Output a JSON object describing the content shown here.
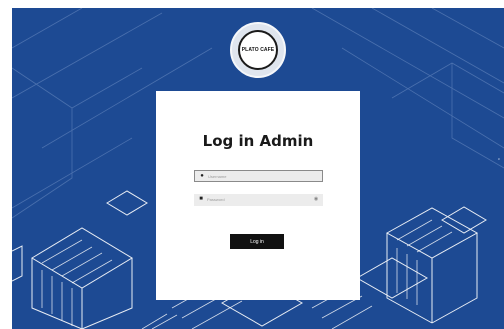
{
  "brand": {
    "logo_text": "PLATO CAFE"
  },
  "login": {
    "title": "Log in Admin",
    "username_placeholder": "Username",
    "password_placeholder": "Password",
    "button_label": "Log in"
  },
  "icons": {
    "user": "user-icon",
    "lock": "lock-icon",
    "eye": "eye-icon"
  },
  "colors": {
    "background": "#1d4a93",
    "card": "#ffffff",
    "button": "#111111"
  }
}
